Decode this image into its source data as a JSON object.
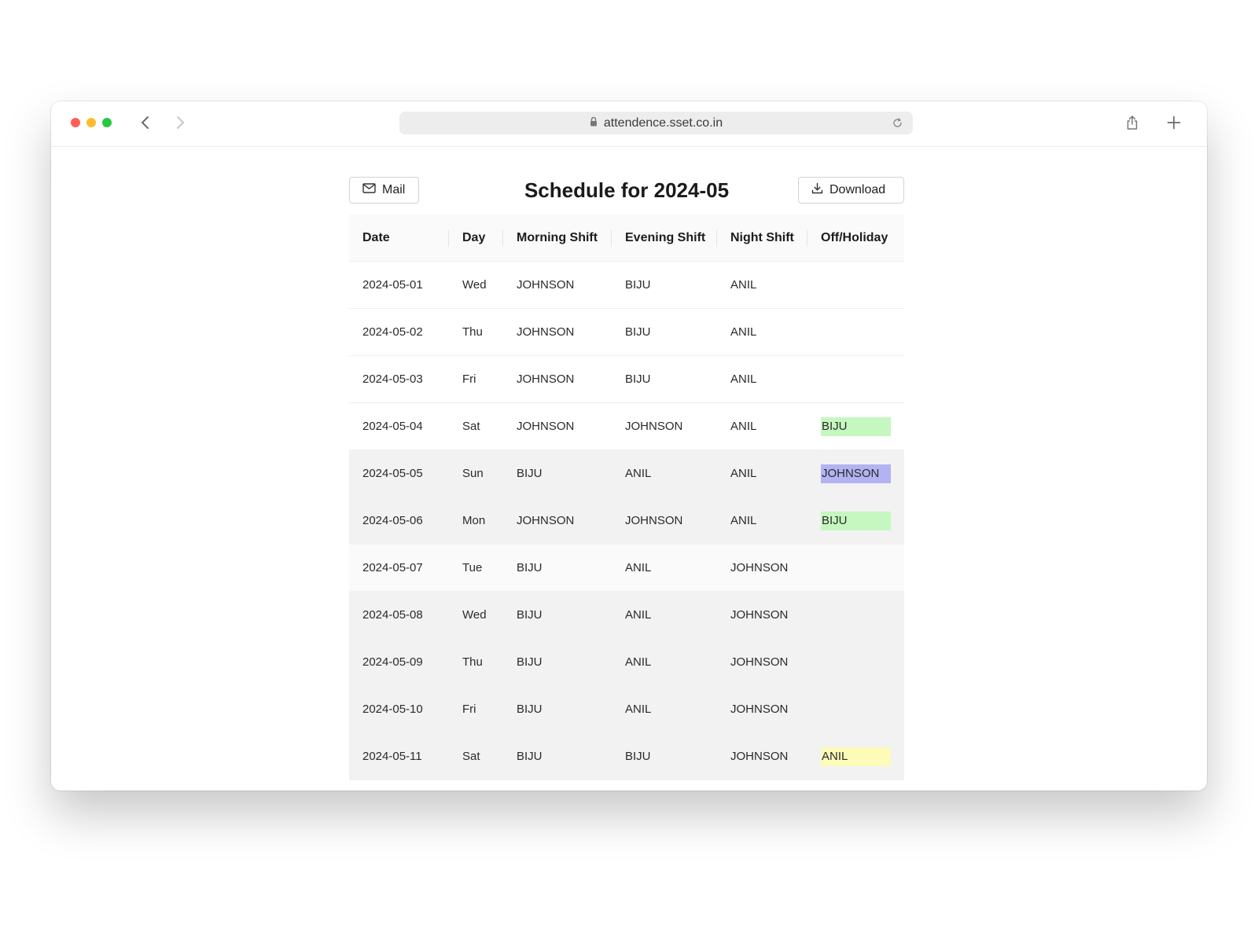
{
  "browser": {
    "url": "attendence.sset.co.in"
  },
  "page": {
    "title": "Schedule for 2024-05",
    "mail_label": "Mail",
    "download_label": "Download"
  },
  "table": {
    "headers": [
      "Date",
      "Day",
      "Morning Shift",
      "Evening Shift",
      "Night Shift",
      "Off/Holiday"
    ],
    "rows": [
      {
        "date": "2024-05-01",
        "day": "Wed",
        "morning": "JOHNSON",
        "evening": "BIJU",
        "night": "ANIL",
        "off": "",
        "off_color": "",
        "row_bg": "white"
      },
      {
        "date": "2024-05-02",
        "day": "Thu",
        "morning": "JOHNSON",
        "evening": "BIJU",
        "night": "ANIL",
        "off": "",
        "off_color": "",
        "row_bg": "white"
      },
      {
        "date": "2024-05-03",
        "day": "Fri",
        "morning": "JOHNSON",
        "evening": "BIJU",
        "night": "ANIL",
        "off": "",
        "off_color": "",
        "row_bg": "white"
      },
      {
        "date": "2024-05-04",
        "day": "Sat",
        "morning": "JOHNSON",
        "evening": "JOHNSON",
        "night": "ANIL",
        "off": "BIJU",
        "off_color": "#c6f7c0",
        "row_bg": "white"
      },
      {
        "date": "2024-05-05",
        "day": "Sun",
        "morning": "BIJU",
        "evening": "ANIL",
        "night": "ANIL",
        "off": "JOHNSON",
        "off_color": "#b3b3f3",
        "row_bg": "grey"
      },
      {
        "date": "2024-05-06",
        "day": "Mon",
        "morning": "JOHNSON",
        "evening": "JOHNSON",
        "night": "ANIL",
        "off": "BIJU",
        "off_color": "#c6f7c0",
        "row_bg": "grey"
      },
      {
        "date": "2024-05-07",
        "day": "Tue",
        "morning": "BIJU",
        "evening": "ANIL",
        "night": "JOHNSON",
        "off": "",
        "off_color": "",
        "row_bg": "light"
      },
      {
        "date": "2024-05-08",
        "day": "Wed",
        "morning": "BIJU",
        "evening": "ANIL",
        "night": "JOHNSON",
        "off": "",
        "off_color": "",
        "row_bg": "grey"
      },
      {
        "date": "2024-05-09",
        "day": "Thu",
        "morning": "BIJU",
        "evening": "ANIL",
        "night": "JOHNSON",
        "off": "",
        "off_color": "",
        "row_bg": "grey"
      },
      {
        "date": "2024-05-10",
        "day": "Fri",
        "morning": "BIJU",
        "evening": "ANIL",
        "night": "JOHNSON",
        "off": "",
        "off_color": "",
        "row_bg": "grey"
      },
      {
        "date": "2024-05-11",
        "day": "Sat",
        "morning": "BIJU",
        "evening": "BIJU",
        "night": "JOHNSON",
        "off": "ANIL",
        "off_color": "#fdfbb8",
        "row_bg": "grey"
      }
    ]
  }
}
